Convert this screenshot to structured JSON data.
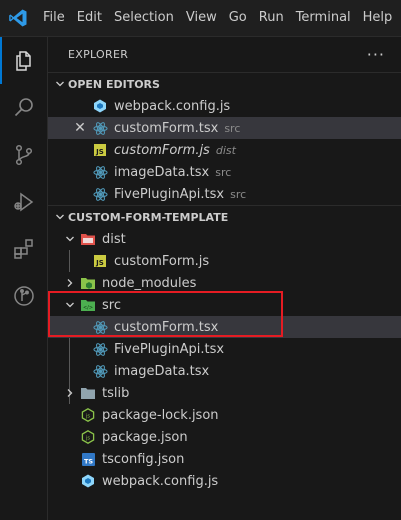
{
  "menu": [
    "File",
    "Edit",
    "Selection",
    "View",
    "Go",
    "Run",
    "Terminal",
    "Help"
  ],
  "sidebar": {
    "title": "EXPLORER",
    "more": "···"
  },
  "open_editors": {
    "header": "OPEN EDITORS",
    "items": [
      {
        "name": "webpack.config.js",
        "desc": "",
        "icon": "webpack-icon",
        "italic": false
      },
      {
        "name": "customForm.tsx",
        "desc": "src",
        "icon": "react-icon",
        "italic": false
      },
      {
        "name": "customForm.js",
        "desc": "dist",
        "icon": "js-icon",
        "italic": true
      },
      {
        "name": "imageData.tsx",
        "desc": "src",
        "icon": "react-icon",
        "italic": false
      },
      {
        "name": "FivePluginApi.tsx",
        "desc": "src",
        "icon": "react-icon",
        "italic": false
      }
    ]
  },
  "project": {
    "header": "CUSTOM-FORM-TEMPLATE",
    "tree": [
      {
        "name": "dist",
        "type": "folder",
        "icon": "dist-folder-icon",
        "expanded": true
      },
      {
        "name": "customForm.js",
        "type": "file",
        "icon": "js-icon"
      },
      {
        "name": "node_modules",
        "type": "folder",
        "icon": "node-folder-icon",
        "expanded": false
      },
      {
        "name": "src",
        "type": "folder",
        "icon": "src-folder-icon",
        "expanded": true
      },
      {
        "name": "customForm.tsx",
        "type": "file",
        "icon": "react-icon"
      },
      {
        "name": "FivePluginApi.tsx",
        "type": "file",
        "icon": "react-icon"
      },
      {
        "name": "imageData.tsx",
        "type": "file",
        "icon": "react-icon"
      },
      {
        "name": "tslib",
        "type": "folder",
        "icon": "folder-icon",
        "expanded": false
      },
      {
        "name": "package-lock.json",
        "type": "file",
        "icon": "nodejs-icon"
      },
      {
        "name": "package.json",
        "type": "file",
        "icon": "nodejs-icon"
      },
      {
        "name": "tsconfig.json",
        "type": "file",
        "icon": "ts-icon"
      },
      {
        "name": "webpack.config.js",
        "type": "file",
        "icon": "webpack-icon"
      }
    ]
  },
  "colors": {
    "accent": "#0078d4",
    "highlight": "#e51c23",
    "react": "#519aba",
    "js": "#cbcb41"
  }
}
